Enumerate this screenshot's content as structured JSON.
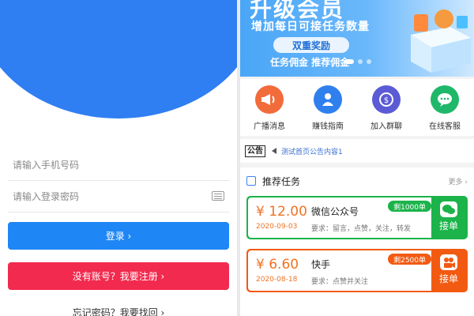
{
  "login": {
    "phone_placeholder": "请输入手机号码",
    "password_placeholder": "请输入登录密码",
    "login_button": "登录 ›",
    "register_button": "没有账号？我要注册 ›",
    "forgot_link": "忘记密码？我要找回 ›"
  },
  "banner": {
    "title": "升级会员",
    "subtitle": "增加每日可接任务数量",
    "pill": "双重奖励",
    "tags": "任务佣金  推荐佣金",
    "dots_count": 3
  },
  "quick": [
    {
      "label": "广播消息",
      "icon": "megaphone-icon",
      "color": "#f26b3a"
    },
    {
      "label": "赚钱指南",
      "icon": "guide-icon",
      "color": "#2f80ed"
    },
    {
      "label": "加入群聊",
      "icon": "group-chat-icon",
      "color": "#5b5bd6"
    },
    {
      "label": "在线客服",
      "icon": "customer-service-icon",
      "color": "#1fb86a"
    }
  ],
  "notice": {
    "tag": "公告",
    "text": "测试首页公告内容1"
  },
  "tasks": {
    "title": "推荐任务",
    "more": "更多 ›",
    "items": [
      {
        "price": "¥ 12.00",
        "date": "2020-09-03",
        "name": "微信公众号",
        "requirement": "要求：留言，点赞，关注，转发",
        "remaining": "剩1000单",
        "take": "接单",
        "color": "#1bb34a",
        "icon": "wechat-icon"
      },
      {
        "price": "¥ 6.60",
        "date": "2020-08-18",
        "name": "快手",
        "requirement": "要求：点赞并关注",
        "remaining": "剩2500单",
        "take": "接单",
        "color": "#f25a12",
        "icon": "kuaishou-icon"
      }
    ]
  },
  "colors": {
    "primary_blue": "#1e86f5",
    "register_red": "#f22a4f",
    "green": "#1bb34a",
    "orange": "#f25a12"
  }
}
